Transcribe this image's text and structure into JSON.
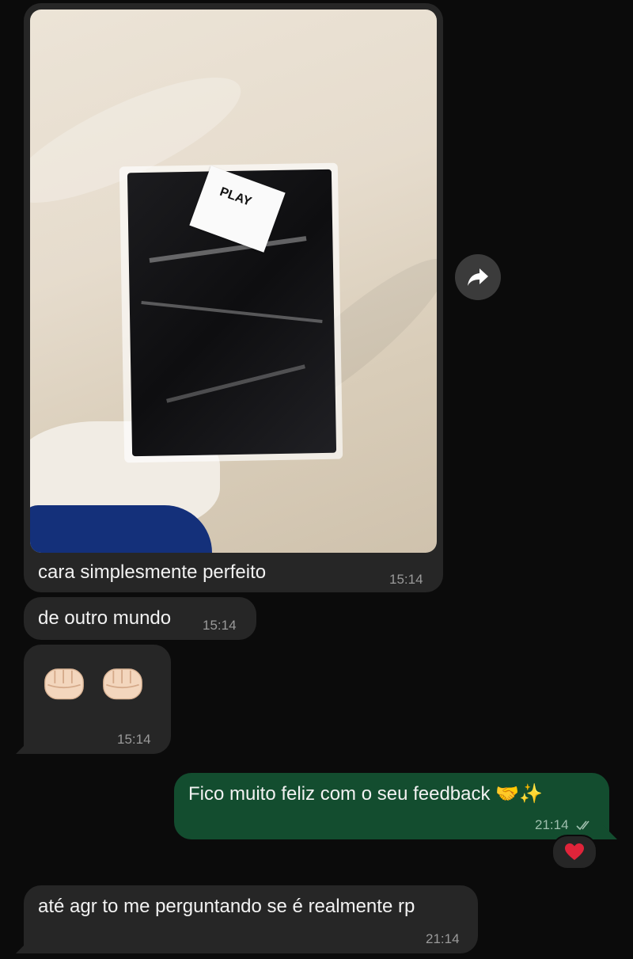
{
  "messages": [
    {
      "text": "cara simplesmente perfeito",
      "time": "15:14",
      "has_photo": true
    },
    {
      "text": "de outro mundo",
      "time": "15:14"
    },
    {
      "emoji": "fist-bump x2",
      "time": "15:14"
    },
    {
      "text": "Fico muito feliz com o seu feedback 🤝✨",
      "time": "21:14",
      "status": "read",
      "reaction": "❤️"
    },
    {
      "text": "até agr to me perguntando se é realmente rp",
      "time": "21:14"
    }
  ],
  "photo": {
    "tag_text": "PLAY"
  },
  "colors": {
    "background": "#0b0b0b",
    "incoming_bubble": "#262626",
    "outgoing_bubble": "#134d2f",
    "text": "#f2f2f2"
  },
  "icons": [
    "forward-icon",
    "double-check-icon",
    "heart-icon",
    "fist-emoji"
  ]
}
